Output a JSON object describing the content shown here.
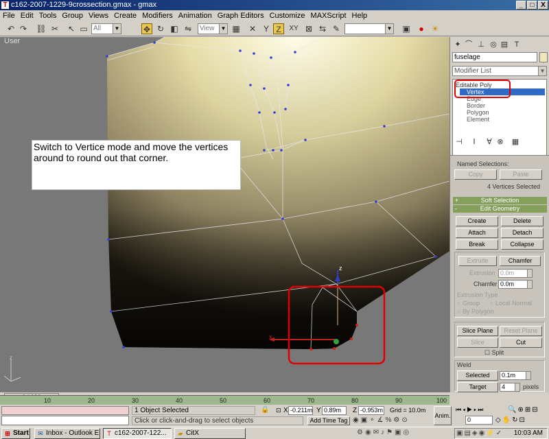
{
  "window": {
    "title": "c162-2007-1229-9crossection.gmax - gmax",
    "min": "_",
    "max": "□",
    "close": "X"
  },
  "menu": [
    "File",
    "Edit",
    "Tools",
    "Group",
    "Views",
    "Create",
    "Modifiers",
    "Animation",
    "Graph Editors",
    "Customize",
    "MAXScript",
    "Help"
  ],
  "toolbar": {
    "selection_filter": "All",
    "ref_coord": "View",
    "xy_label": "XY"
  },
  "viewport": {
    "label": "User",
    "gizmo_z": "z",
    "gizmo_x": "x"
  },
  "annotation": {
    "text": "Switch to Vertice mode and move the vertices around to round out that corner."
  },
  "command_panel": {
    "object_name": "fuselage",
    "modifier_list": "Modifier List",
    "stack": {
      "root": "Editable Poly",
      "items": [
        "Vertex",
        "Edge",
        "Border",
        "Polygon",
        "Element"
      ],
      "selected": "Vertex"
    },
    "named_selections": {
      "title": "Named Selections:",
      "copy": "Copy",
      "paste": "Paste",
      "status": "4 Vertices Selected"
    },
    "soft_selection": "Soft Selection",
    "edit_geometry": {
      "title": "Edit Geometry",
      "create": "Create",
      "delete": "Delete",
      "attach": "Attach",
      "detach": "Detach",
      "break": "Break",
      "collapse": "Collapse",
      "extrude": "Extrude",
      "chamfer": "Chamfer",
      "extrusion_label": "Extrusion",
      "extrusion_value": "0.0m",
      "chamfer_label": "Chamfer",
      "chamfer_value": "0.0m",
      "extrusion_type": "Extrusion Type",
      "group": "Group",
      "local_normal": "Local Normal",
      "by_polygon": "By Polygon",
      "slice_plane": "Slice Plane",
      "reset_plane": "Reset Plane",
      "slice": "Slice",
      "cut": "Cut",
      "split": "Split"
    },
    "weld": {
      "title": "Weld",
      "selected": "Selected",
      "selected_value": "0.1m",
      "target": "Target",
      "target_value": "4",
      "pixels": "pixels"
    }
  },
  "timeline": {
    "frame": "0 / 100",
    "ticks": [
      "10",
      "20",
      "30",
      "40",
      "50",
      "60",
      "70",
      "80",
      "90",
      "100"
    ]
  },
  "status": {
    "objects": "1 Object Selected",
    "prompt": "Click or click-and-drag to select objects",
    "x_label": "X",
    "x": "-0.211m",
    "y_label": "Y",
    "y": "0.89m",
    "z_label": "Z",
    "z": "-0.953m",
    "grid": "Grid = 10.0m",
    "add_time_tag": "Add Time Tag",
    "anim": "Anim.",
    "frame_field": "0"
  },
  "taskbar": {
    "start": "Start",
    "tasks": [
      {
        "label": "Inbox - Outlook E...",
        "icon": "outlook-icon"
      },
      {
        "label": "c162-2007-122...",
        "icon": "gmax-icon"
      },
      {
        "label": "CitX",
        "icon": "folder-icon"
      }
    ],
    "clock": "10:03 AM"
  },
  "colors": {
    "titlebar": "#0a246a",
    "rollout": "#84a05c",
    "highlight_box": "#e00000",
    "selection": "#316ac5"
  }
}
